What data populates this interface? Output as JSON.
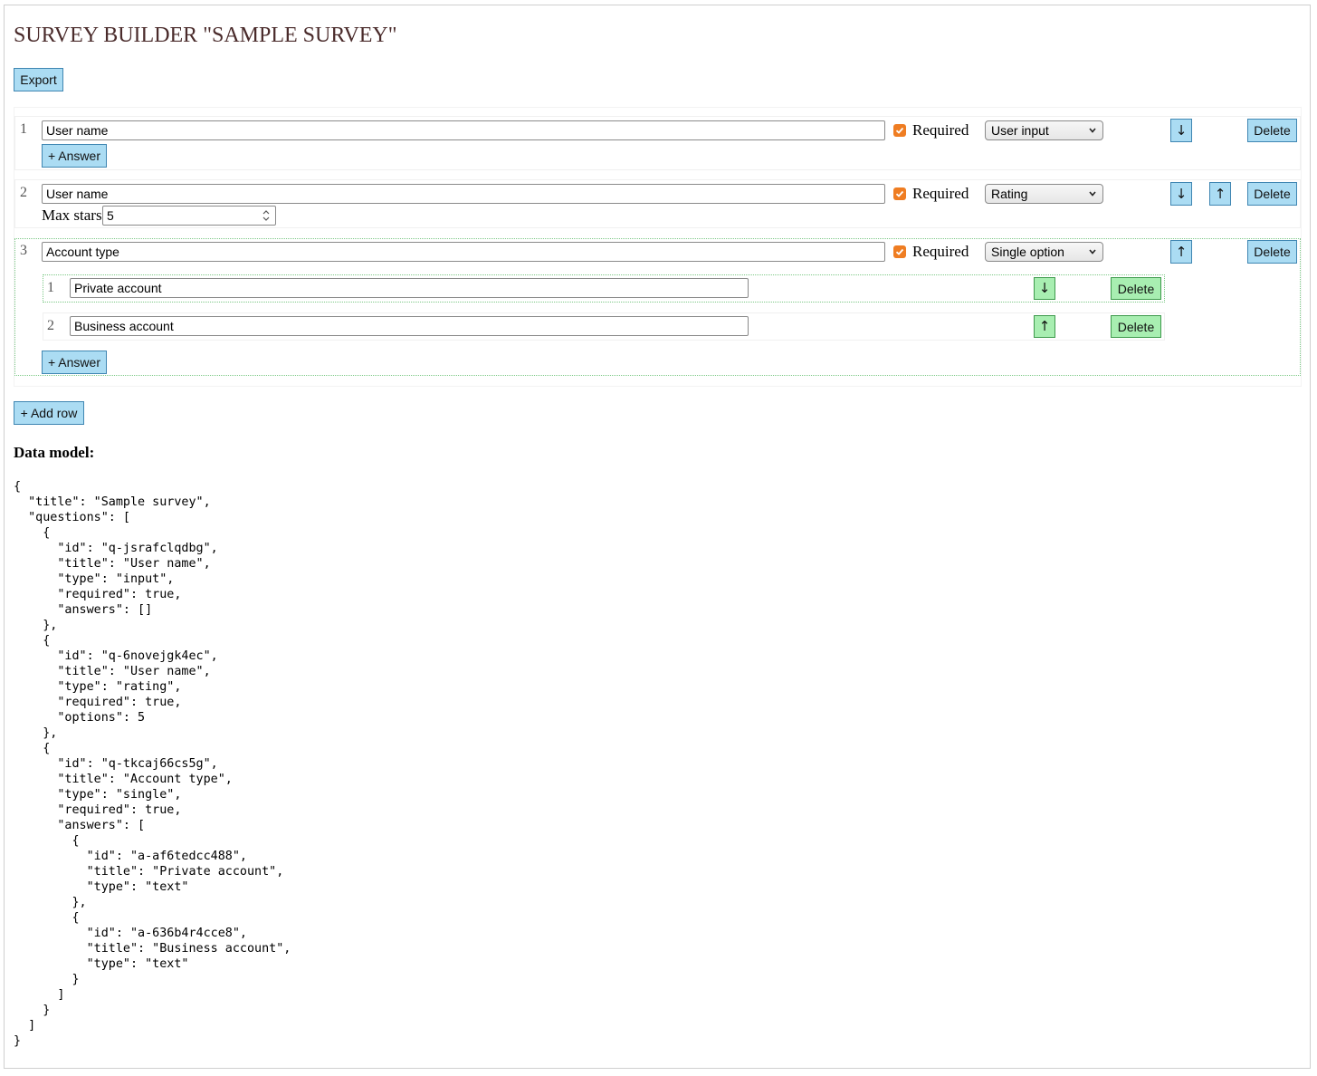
{
  "header": {
    "title": "SURVEY BUILDER \"SAMPLE SURVEY\"",
    "export_label": "Export"
  },
  "questions": [
    {
      "index": "1",
      "title": "User name",
      "required_label": "Required",
      "required": true,
      "type_label": "User input",
      "delete_label": "Delete",
      "add_answer_label": "+ Answer"
    },
    {
      "index": "2",
      "title": "User name",
      "required_label": "Required",
      "required": true,
      "type_label": "Rating",
      "delete_label": "Delete",
      "max_stars_label": "Max stars",
      "max_stars_value": "5"
    },
    {
      "index": "3",
      "title": "Account type",
      "required_label": "Required",
      "required": true,
      "type_label": "Single option",
      "delete_label": "Delete",
      "add_answer_label": "+ Answer",
      "answers": [
        {
          "index": "1",
          "title": "Private account",
          "delete_label": "Delete"
        },
        {
          "index": "2",
          "title": "Business account",
          "delete_label": "Delete"
        }
      ]
    }
  ],
  "icons": {
    "down": "↓",
    "up": "↑"
  },
  "add_row_label": "+ Add row",
  "data_model_heading": "Data model:",
  "data_model_json": "{\n  \"title\": \"Sample survey\",\n  \"questions\": [\n    {\n      \"id\": \"q-jsrafclqdbg\",\n      \"title\": \"User name\",\n      \"type\": \"input\",\n      \"required\": true,\n      \"answers\": []\n    },\n    {\n      \"id\": \"q-6novejgk4ec\",\n      \"title\": \"User name\",\n      \"type\": \"rating\",\n      \"required\": true,\n      \"options\": 5\n    },\n    {\n      \"id\": \"q-tkcaj66cs5g\",\n      \"title\": \"Account type\",\n      \"type\": \"single\",\n      \"required\": true,\n      \"answers\": [\n        {\n          \"id\": \"a-af6tedcc488\",\n          \"title\": \"Private account\",\n          \"type\": \"text\"\n        },\n        {\n          \"id\": \"a-636b4r4cce8\",\n          \"title\": \"Business account\",\n          \"type\": \"text\"\n        }\n      ]\n    }\n  ]\n}",
  "colors": {
    "button_blue": "#abdcf3",
    "button_green": "#a8eeb1",
    "checkbox_orange": "#ef7d22",
    "title_color": "#4a2b2b"
  }
}
